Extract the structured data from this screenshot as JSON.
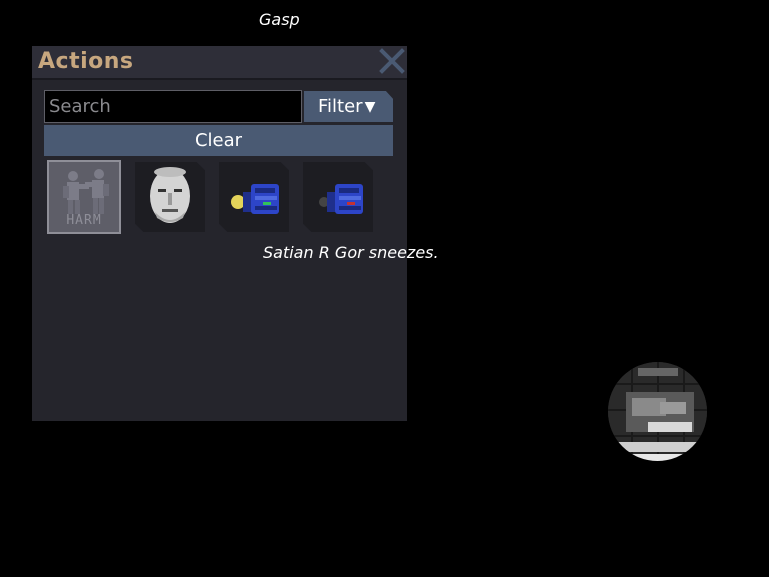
{
  "overlay": {
    "emote_top": "Gasp",
    "chat_message": "Satian R Gor sneezes."
  },
  "actions_window": {
    "title": "Actions",
    "close_icon": "close-x-icon",
    "search": {
      "value": "",
      "placeholder": "Search"
    },
    "filter_label": "Filter",
    "clear_label": "Clear",
    "slots": [
      {
        "icon": "harm-intent-icon",
        "label": "HARM",
        "selected": true
      },
      {
        "icon": "face-emote-icon",
        "selected": false
      },
      {
        "icon": "flashlight-on-icon",
        "selected": false
      },
      {
        "icon": "flashlight-off-icon",
        "selected": false
      }
    ]
  },
  "colors": {
    "window_bg": "#25252c",
    "title_color": "#c7a77f",
    "button_bg": "#4a5a73"
  }
}
